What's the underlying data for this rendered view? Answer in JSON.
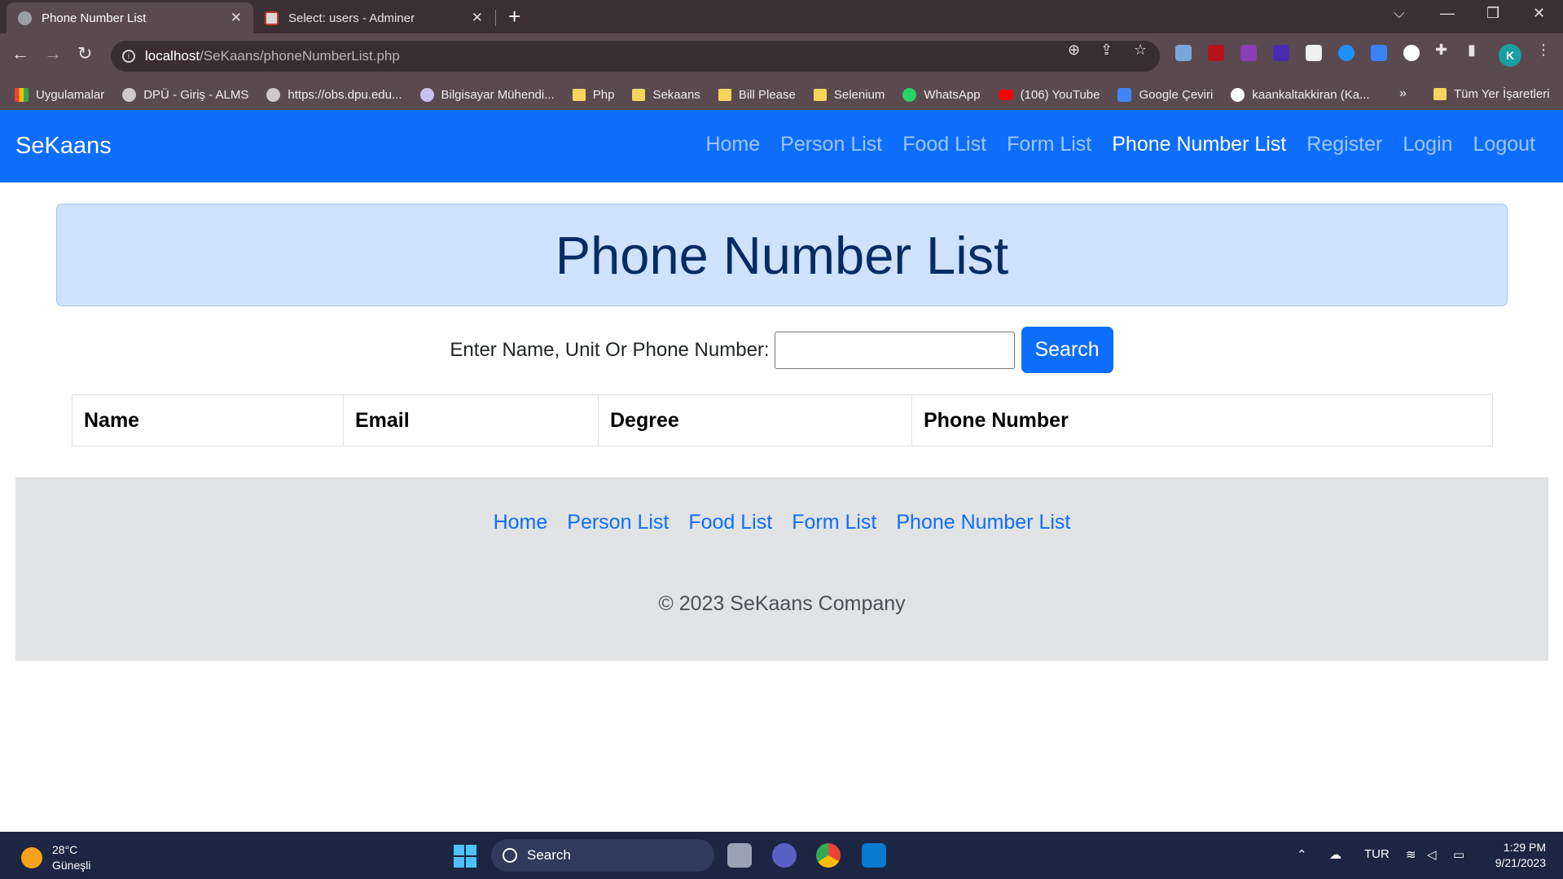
{
  "browser": {
    "tabs": [
      {
        "title": "Phone Number List",
        "active": true
      },
      {
        "title": "Select: users - Adminer",
        "active": false
      }
    ],
    "url_host": "localhost",
    "url_path": "/SeKaans/phoneNumberList.php",
    "profile_initial": "K",
    "bookmarks": [
      {
        "label": "Uygulamalar",
        "icon": "apps-icon"
      },
      {
        "label": "DPÜ - Giriş - ALMS",
        "icon": "globe-icon"
      },
      {
        "label": "https://obs.dpu.edu...",
        "icon": "globe-icon"
      },
      {
        "label": "Bilgisayar Mühendi...",
        "icon": "site-icon"
      },
      {
        "label": "Php",
        "icon": "folder-icon"
      },
      {
        "label": "Sekaans",
        "icon": "folder-icon"
      },
      {
        "label": "Bill Please",
        "icon": "folder-icon"
      },
      {
        "label": "Selenium",
        "icon": "folder-icon"
      },
      {
        "label": "WhatsApp",
        "icon": "whatsapp-icon"
      },
      {
        "label": "(106) YouTube",
        "icon": "youtube-icon"
      },
      {
        "label": "Google Çeviri",
        "icon": "translate-icon"
      },
      {
        "label": "kaankaltakkiran (Ka...",
        "icon": "github-icon"
      }
    ],
    "bookmarks_more": "»",
    "all_bookmarks": "Tüm Yer İşaretleri"
  },
  "site": {
    "brand": "SeKaans",
    "nav": [
      {
        "label": "Home",
        "active": false
      },
      {
        "label": "Person List",
        "active": false
      },
      {
        "label": "Food List",
        "active": false
      },
      {
        "label": "Form List",
        "active": false
      },
      {
        "label": "Phone Number List",
        "active": true
      },
      {
        "label": "Register",
        "active": false
      },
      {
        "label": "Login",
        "active": false
      },
      {
        "label": "Logout",
        "active": false
      }
    ],
    "heading": "Phone Number List",
    "search": {
      "label": "Enter Name, Unit Or Phone Number:",
      "value": "",
      "button": "Search"
    },
    "table": {
      "headers": [
        "Name",
        "Email",
        "Degree",
        "Phone Number"
      ]
    },
    "footer": {
      "links": [
        "Home",
        "Person List",
        "Food List",
        "Form List",
        "Phone Number List"
      ],
      "copyright": "© 2023 SeKaans Company"
    }
  },
  "taskbar": {
    "temperature": "28°C",
    "weather": "Güneşli",
    "search_label": "Search",
    "language": "TUR",
    "time": "1:29 PM",
    "date": "9/21/2023"
  },
  "colors": {
    "primary": "#0d6efd",
    "hero_bg": "#cfe2ff",
    "hero_text": "#052c65",
    "footer_bg": "#e2e3e5"
  }
}
